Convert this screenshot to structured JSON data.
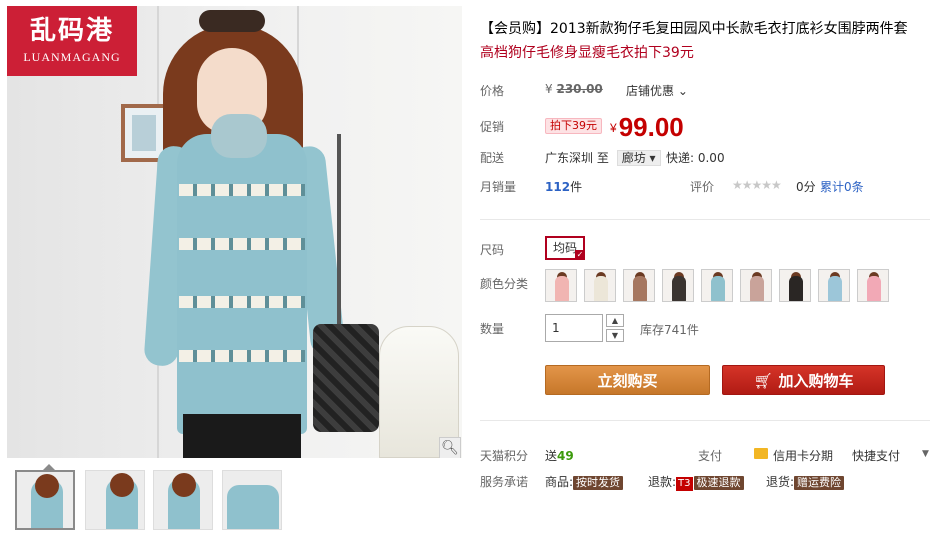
{
  "logo": {
    "cn": "乱码港",
    "en": "LUANMAGANG"
  },
  "product": {
    "title": "【会员购】2013新款狗仔毛复田园风中长款毛衣打底衫女围脖两件套",
    "subtitle": "高档狗仔毛修身显瘦毛衣拍下39元"
  },
  "price": {
    "label": "价格",
    "currency": "¥",
    "original": "230.00",
    "shop_discount": "店铺优惠",
    "promo_label": "促销",
    "promo_tag": "拍下39元",
    "promo_price": "99.00"
  },
  "shipping": {
    "label": "配送",
    "from": "广东深圳",
    "to_word": "至",
    "to": "廊坊",
    "express": "快递: 0.00"
  },
  "sales": {
    "label": "月销量",
    "count": "112",
    "unit": "件",
    "rating_label": "评价",
    "stars": "★★★★★",
    "score": "0分",
    "reviews": "累计0条"
  },
  "options": {
    "size_label": "尺码",
    "size_value": "均码",
    "color_label": "颜色分类",
    "colors": [
      "#f1b5b2",
      "#ece6d8",
      "#a67760",
      "#3a3430",
      "#8fc1cd",
      "#c9a39a",
      "#2a2624",
      "#9cc6d9",
      "#f2a9b6"
    ],
    "qty_label": "数量",
    "qty_value": "1",
    "stock": "库存741件"
  },
  "actions": {
    "buy": "立刻购买",
    "cart": "加入购物车"
  },
  "footer": {
    "points_label": "天猫积分",
    "points_prefix": "送",
    "points_value": "49",
    "pay_label": "支付",
    "card": "信用卡分期",
    "quick": "快捷支付",
    "service_label": "服务承诺",
    "goods": "商品:",
    "goods_tag": "按时发货",
    "refund": "退款:",
    "refund_t3": "T3",
    "refund_tag": "极速退款",
    "return": "退货:",
    "return_tag": "赠运费险"
  }
}
